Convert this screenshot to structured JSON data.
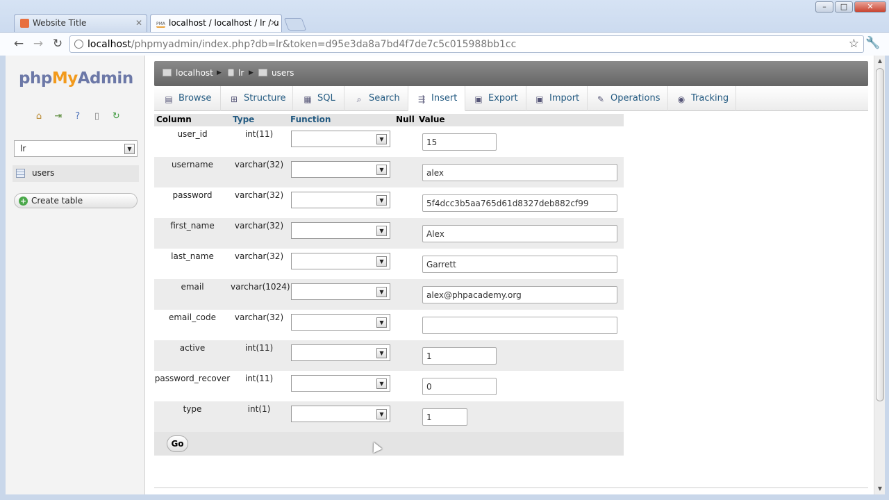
{
  "browser": {
    "tabs": [
      {
        "title": "Website Title",
        "active": false
      },
      {
        "title": "localhost / localhost / lr / u",
        "active": true
      }
    ],
    "favicon_text": "PMA",
    "url_host": "localhost",
    "url_rest": "/phpmyadmin/index.php?db=lr&token=d95e3da8a7bd4f7de7c5c015988bb1cc"
  },
  "sidebar": {
    "logo": {
      "php": "php",
      "my": "My",
      "admin": "Admin"
    },
    "db_selected": "lr",
    "tables": [
      "users"
    ],
    "create_table_label": "Create table"
  },
  "breadcrumb": {
    "server": "localhost",
    "database": "lr",
    "table": "users"
  },
  "tabs": [
    "Browse",
    "Structure",
    "SQL",
    "Search",
    "Insert",
    "Export",
    "Import",
    "Operations",
    "Tracking"
  ],
  "active_tab": "Insert",
  "columns_header": {
    "column": "Column",
    "type": "Type",
    "function": "Function",
    "null": "Null",
    "value": "Value"
  },
  "fields": [
    {
      "name": "user_id",
      "type": "int(11)",
      "value": "15"
    },
    {
      "name": "username",
      "type": "varchar(32)",
      "value": "alex"
    },
    {
      "name": "password",
      "type": "varchar(32)",
      "value": "5f4dcc3b5aa765d61d8327deb882cf99"
    },
    {
      "name": "first_name",
      "type": "varchar(32)",
      "value": "Alex"
    },
    {
      "name": "last_name",
      "type": "varchar(32)",
      "value": "Garrett"
    },
    {
      "name": "email",
      "type": "varchar(1024)",
      "value": "alex@phpacademy.org"
    },
    {
      "name": "email_code",
      "type": "varchar(32)",
      "value": ""
    },
    {
      "name": "active",
      "type": "int(11)",
      "value": "1"
    },
    {
      "name": "password_recover",
      "type": "int(11)",
      "value": "0"
    },
    {
      "name": "type",
      "type": "int(1)",
      "value": "1"
    }
  ],
  "go_label": "Go",
  "colors": {
    "accent_link": "#235a81",
    "logo_orange": "#f29a1c",
    "logo_blue": "#6c78a7"
  }
}
